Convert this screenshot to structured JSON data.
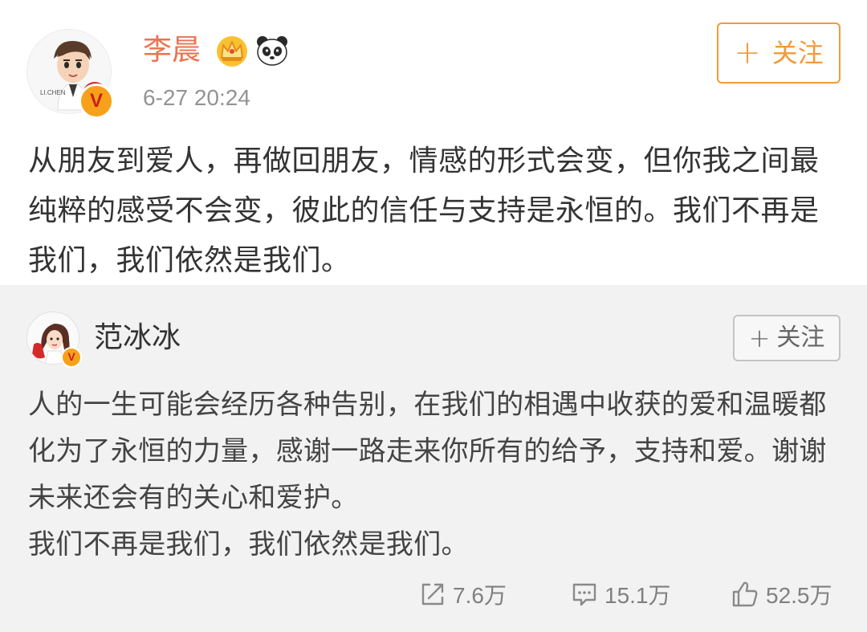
{
  "post": {
    "author": "李晨",
    "timestamp": "6-27 20:24",
    "follow_label": "关注",
    "avatar_caption": "LI.CHEN",
    "badges": [
      "crown-icon",
      "panda-icon",
      "verified-v-icon"
    ],
    "text": "从朋友到爱人，再做回朋友，情感的形式会变，但你我之间最纯粹的感受不会变，彼此的信任与支持是永恒的。我们不再是我们，我们依然是我们。"
  },
  "repost": {
    "author": "范冰冰",
    "follow_label": "关注",
    "paragraphs": [
      "人的一生可能会经历各种告别，在我们的相遇中收获的爱和温暖都化为了永恒的力量，感谢一路走来你所有的给予，支持和爱。谢谢未来还会有的关心和爱护。",
      "我们不再是我们，我们依然是我们。"
    ],
    "stats": {
      "reposts": "7.6万",
      "comments": "15.1万",
      "likes": "52.5万"
    }
  },
  "colors": {
    "author_name": "#eb7350",
    "follow_accent": "#f29b3a",
    "verified_badge": "#f7a11a",
    "repost_background": "#f2f2f2",
    "muted_text": "#939393"
  }
}
